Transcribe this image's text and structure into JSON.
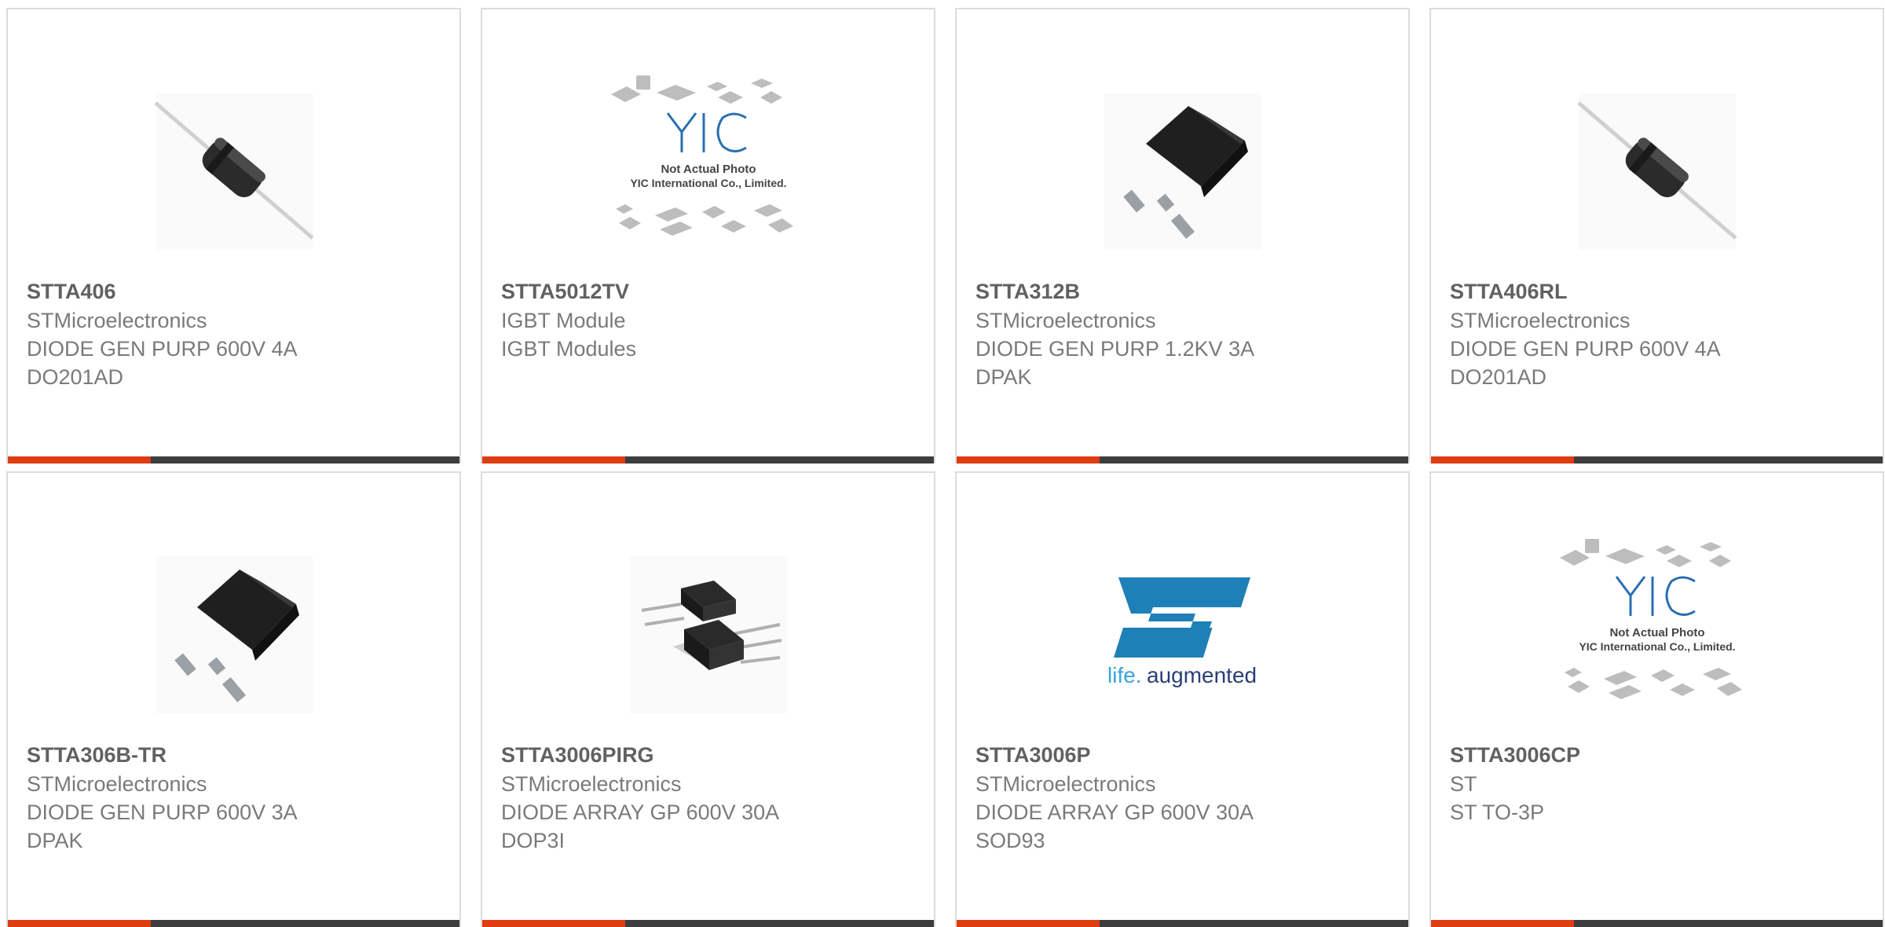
{
  "products": [
    {
      "part": "STTA406",
      "maker": "STMicroelectronics",
      "desc": "DIODE GEN PURP 600V 4A",
      "pkg": "DO201AD",
      "image": "axial-diode-photo"
    },
    {
      "part": "STTA5012TV",
      "maker": "IGBT Module",
      "desc": "IGBT Modules",
      "pkg": "",
      "image": "yic-not-actual-photo-placeholder",
      "placeholder_text": [
        "Not Actual Photo",
        "YIC International Co., Limited."
      ]
    },
    {
      "part": "STTA312B",
      "maker": "STMicroelectronics",
      "desc": "DIODE GEN PURP 1.2KV 3A",
      "pkg": "DPAK",
      "image": "dpak-package-photo"
    },
    {
      "part": "STTA406RL",
      "maker": "STMicroelectronics",
      "desc": "DIODE GEN PURP 600V 4A",
      "pkg": "DO201AD",
      "image": "axial-diode-photo"
    },
    {
      "part": "STTA306B-TR",
      "maker": "STMicroelectronics",
      "desc": "DIODE GEN PURP 600V 3A",
      "pkg": "DPAK",
      "image": "dpak-package-photo"
    },
    {
      "part": "STTA3006PIRG",
      "maker": "STMicroelectronics",
      "desc": "DIODE ARRAY GP 600V 30A",
      "pkg": "DOP3I",
      "image": "to-package-pair-photo"
    },
    {
      "part": "STTA3006P",
      "maker": "STMicroelectronics",
      "desc": "DIODE ARRAY GP 600V 30A",
      "pkg": "SOD93",
      "image": "st-logo",
      "logo_text": [
        "life.",
        "augmented"
      ]
    },
    {
      "part": "STTA3006CP",
      "maker": "ST",
      "desc": "ST TO-3P",
      "pkg": "",
      "image": "yic-not-actual-photo-placeholder",
      "placeholder_text": [
        "Not Actual Photo",
        "YIC International Co., Limited."
      ]
    }
  ],
  "colors": {
    "accent": "#e03c12",
    "bar": "#3d3d3d",
    "logo_blue": "#1f7fb7"
  }
}
